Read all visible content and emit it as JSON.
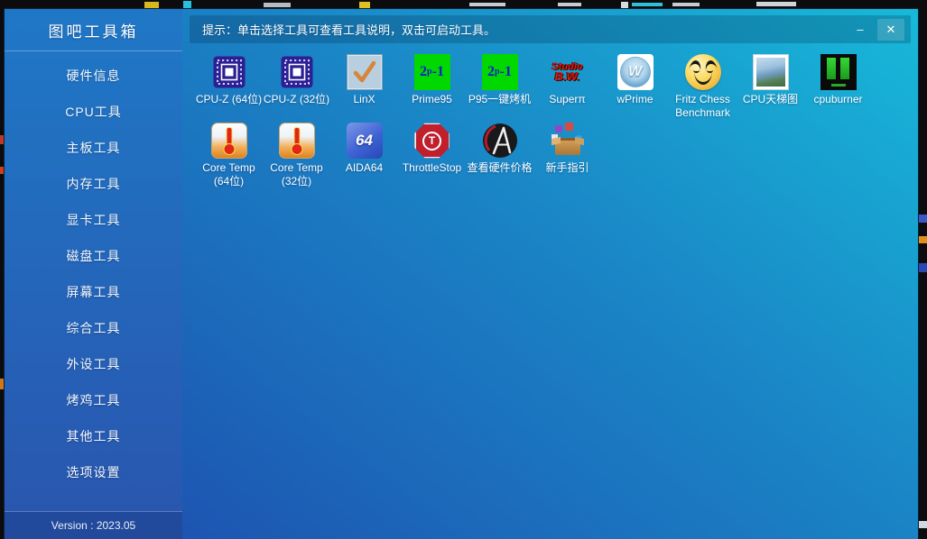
{
  "window": {
    "title": "图吧工具箱",
    "version": "Version : 2023.05"
  },
  "sidebar": {
    "items": [
      {
        "id": "hardware-info",
        "label": "硬件信息"
      },
      {
        "id": "cpu-tools",
        "label": "CPU工具"
      },
      {
        "id": "motherboard-tools",
        "label": "主板工具"
      },
      {
        "id": "memory-tools",
        "label": "内存工具"
      },
      {
        "id": "gpu-tools",
        "label": "显卡工具"
      },
      {
        "id": "disk-tools",
        "label": "磁盘工具"
      },
      {
        "id": "screen-tools",
        "label": "屏幕工具"
      },
      {
        "id": "comprehensive-tools",
        "label": "综合工具"
      },
      {
        "id": "peripheral-tools",
        "label": "外设工具"
      },
      {
        "id": "stress-tools",
        "label": "烤鸡工具"
      },
      {
        "id": "other-tools",
        "label": "其他工具"
      },
      {
        "id": "settings",
        "label": "选项设置"
      }
    ]
  },
  "tipbar": {
    "text": "提示：单击选择工具可查看工具说明，双击可启动工具。",
    "minimize": "–",
    "close": "✕"
  },
  "tools": {
    "rows": [
      [
        {
          "id": "cpuz-64",
          "label": "CPU-Z (64位)",
          "icon": "cpu-chip"
        },
        {
          "id": "cpuz-32",
          "label": "CPU-Z (32位)",
          "icon": "cpu-chip"
        },
        {
          "id": "linx",
          "label": "LinX",
          "icon": "checkmark"
        },
        {
          "id": "prime95",
          "label": "Prime95",
          "icon": "prime95"
        },
        {
          "id": "p95-bake",
          "label": "P95一键烤机",
          "icon": "prime95"
        },
        {
          "id": "superpi",
          "label": "Superπ",
          "icon": "studio-bw"
        },
        {
          "id": "wprime",
          "label": "wPrime",
          "icon": "wprime"
        },
        {
          "id": "fritz-chess",
          "label": "Fritz Chess Benchmark",
          "icon": "smiley"
        },
        {
          "id": "cpu-ladder",
          "label": "CPU天梯图",
          "icon": "picture"
        },
        {
          "id": "cpuburner",
          "label": "cpuburner",
          "icon": "green-bars"
        }
      ],
      [
        {
          "id": "coretemp-64",
          "label": "Core Temp (64位)",
          "icon": "thermometer"
        },
        {
          "id": "coretemp-32",
          "label": "Core Temp (32位)",
          "icon": "thermometer"
        },
        {
          "id": "aida64",
          "label": "AIDA64",
          "icon": "aida64"
        },
        {
          "id": "throttlestop",
          "label": "ThrottleStop",
          "icon": "stop-sign"
        },
        {
          "id": "hardware-price",
          "label": "查看硬件价格",
          "icon": "price-logo"
        },
        {
          "id": "beginner-guide",
          "label": "新手指引",
          "icon": "guide-box"
        }
      ]
    ]
  },
  "icon_texts": {
    "prime95_base": "2",
    "prime95_sup": "p",
    "prime95_rest": "-1",
    "studio_line1": "Studio",
    "studio_line2": "B.W.",
    "wprime_letter": "W",
    "aida64_text": "64",
    "throttlestop_letter": "T"
  },
  "colors": {
    "sidebar_top": "#1f78c6",
    "sidebar_bottom": "#2a55ae",
    "main_bottom_left": "#1d55b2",
    "main_top_right": "#17b9d9",
    "tipbar_overlay": "rgba(2,28,58,0.22)",
    "prime_green": "#00d800",
    "stop_red": "#c01f2e"
  }
}
